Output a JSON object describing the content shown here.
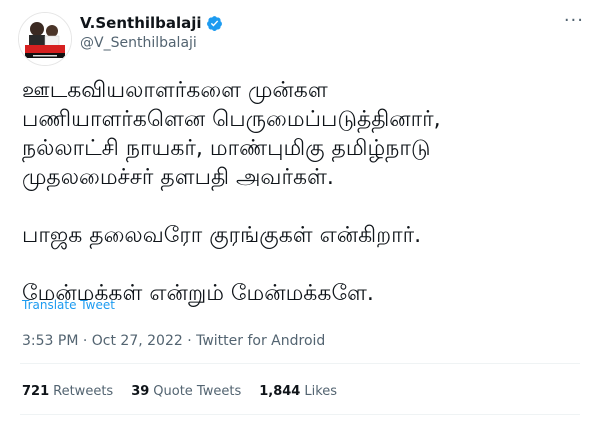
{
  "author": {
    "display_name": "V.Senthilbalaji",
    "handle": "@V_Senthilbalaji",
    "verified": true
  },
  "tweet": {
    "lines_p1": [
      "ஊடகவியலாளர்களை முன்கள",
      "பணியாளர்களென பெருமைப்படுத்தினார்,",
      "நல்லாட்சி நாயகர், மாண்புமிகு தமிழ்நாடு",
      "முதலமைச்சர் தளபதி அவர்கள்."
    ],
    "line_p2": "பாஜக தலைவரோ குரங்குகள் என்கிறார்.",
    "line_p3": "மேன்மக்கள் என்றும் மேன்மக்களே.",
    "translate_label": "Translate Tweet",
    "timestamp_source": "3:53 PM · Oct 27, 2022 · Twitter for Android"
  },
  "stats": {
    "retweets_count": "721",
    "retweets_label": "Retweets",
    "quotes_count": "39",
    "quotes_label": "Quote Tweets",
    "likes_count": "1,844",
    "likes_label": "Likes"
  },
  "colors": {
    "link": "#1d9bf0",
    "secondary_text": "#536471",
    "verified_badge": "#1d9bf0"
  },
  "icons": [
    "avatar",
    "verified-icon",
    "more-icon"
  ]
}
